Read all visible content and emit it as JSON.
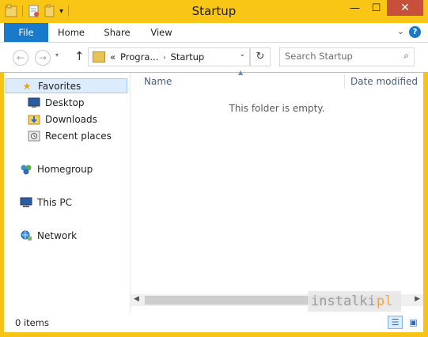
{
  "window": {
    "title": "Startup"
  },
  "quick_access_toolbar": {
    "items": [
      {
        "icon": "folder-icon"
      },
      {
        "icon": "properties-icon"
      },
      {
        "icon": "new-folder-icon"
      },
      {
        "icon": "customize-dropdown-icon",
        "glyph": "▾"
      }
    ]
  },
  "window_controls": {
    "minimize": "—",
    "maximize": "☐",
    "close": "✕"
  },
  "ribbon": {
    "tabs": [
      "File",
      "Home",
      "Share",
      "View"
    ],
    "expand_glyph": "⌄",
    "help_glyph": "?"
  },
  "navigation": {
    "back_glyph": "←",
    "forward_glyph": "→",
    "recent_glyph": "▾",
    "up_glyph": "↑"
  },
  "address": {
    "overflow": "«",
    "crumbs": [
      "Progra...",
      "Startup"
    ],
    "separator": "›",
    "dropdown_glyph": "⌄",
    "refresh_glyph": "↻"
  },
  "search": {
    "placeholder": "Search Startup",
    "icon_glyph": "⌕"
  },
  "nav_pane": {
    "favorites": {
      "label": "Favorites",
      "icon": "star-icon"
    },
    "favorite_items": [
      {
        "label": "Desktop",
        "icon": "desktop-icon"
      },
      {
        "label": "Downloads",
        "icon": "downloads-icon"
      },
      {
        "label": "Recent places",
        "icon": "recent-places-icon"
      }
    ],
    "homegroup": "Homegroup",
    "this_pc": "This PC",
    "network": "Network"
  },
  "content": {
    "columns": {
      "name": "Name",
      "date_modified": "Date modified"
    },
    "sort_glyph": "▲",
    "empty_message": "This folder is empty."
  },
  "watermark": {
    "text": "instalki",
    "suffix": "pl"
  },
  "status": {
    "item_count": "0 items"
  },
  "views": {
    "details_glyph": "☰",
    "large_glyph": "▣"
  },
  "colors": {
    "accent": "#1979ca",
    "titlebar": "#f9c615",
    "close": "#c7503a",
    "selection": "#dcecfc"
  }
}
